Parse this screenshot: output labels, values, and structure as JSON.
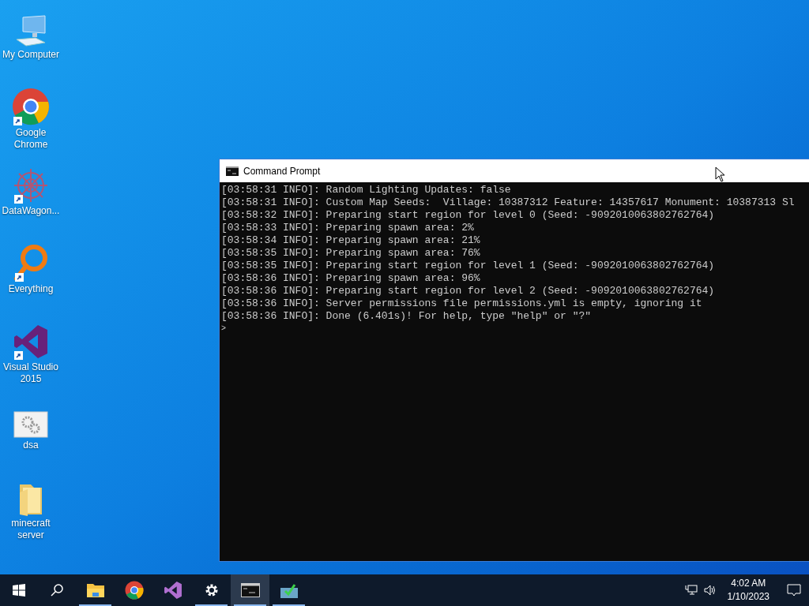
{
  "desktop_icons": [
    {
      "kind": "computer",
      "label": "My Computer",
      "shortcut": false
    },
    {
      "kind": "chrome",
      "label": "Google Chrome",
      "shortcut": true
    },
    {
      "kind": "datawagon",
      "label": "DataWagon...",
      "shortcut": true
    },
    {
      "kind": "everything",
      "label": "Everything",
      "shortcut": true
    },
    {
      "kind": "visualstudio",
      "label": "Visual Studio 2015",
      "shortcut": true
    },
    {
      "kind": "app",
      "label": "dsa",
      "shortcut": false
    },
    {
      "kind": "folder",
      "label": "minecraft server",
      "shortcut": false
    }
  ],
  "console_window": {
    "title": "Command Prompt",
    "lines": [
      "[03:58:31 INFO]: Random Lighting Updates: false",
      "[03:58:31 INFO]: Custom Map Seeds:  Village: 10387312 Feature: 14357617 Monument: 10387313 Sl",
      "[03:58:32 INFO]: Preparing start region for level 0 (Seed: -9092010063802762764)",
      "[03:58:33 INFO]: Preparing spawn area: 2%",
      "[03:58:34 INFO]: Preparing spawn area: 21%",
      "[03:58:35 INFO]: Preparing spawn area: 76%",
      "[03:58:35 INFO]: Preparing start region for level 1 (Seed: -9092010063802762764)",
      "[03:58:36 INFO]: Preparing spawn area: 96%",
      "[03:58:36 INFO]: Preparing start region for level 2 (Seed: -9092010063802762764)",
      "[03:58:36 INFO]: Server permissions file permissions.yml is empty, ignoring it",
      "[03:58:36 INFO]: Done (6.401s)! For help, type \"help\" or \"?\""
    ],
    "prompt": ">"
  },
  "taskbar": {
    "apps": [
      {
        "kind": "explorer",
        "running": true,
        "selected": false
      },
      {
        "kind": "chrome",
        "running": false,
        "selected": false
      },
      {
        "kind": "visualstudio",
        "running": false,
        "selected": false
      },
      {
        "kind": "settings",
        "running": true,
        "selected": false
      },
      {
        "kind": "console",
        "running": true,
        "selected": true
      },
      {
        "kind": "network-tool",
        "running": true,
        "selected": false
      }
    ],
    "time": "4:02 AM",
    "date": "1/10/2023"
  }
}
